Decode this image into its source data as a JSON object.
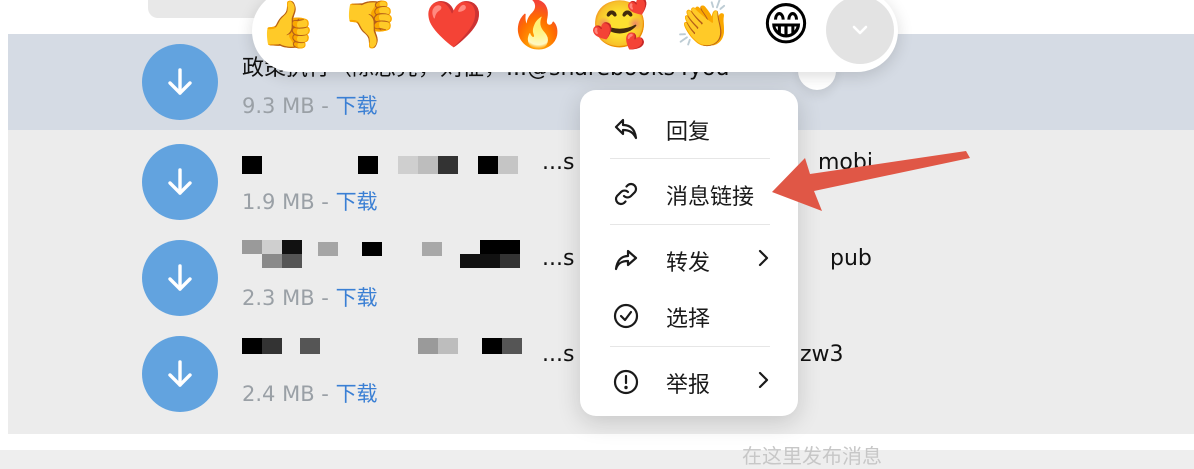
{
  "messages": [
    {
      "name": "政策执行（陈思亮，刘征，...@sharebooks4you",
      "size": "9.3 MB",
      "sep": "-",
      "action": "下载"
    },
    {
      "name": "...s",
      "name_tail": "mobi",
      "size": "1.9 MB",
      "sep": "-",
      "action": "下载"
    },
    {
      "name": "...s",
      "name_tail": "pub",
      "size": "2.3 MB",
      "sep": "-",
      "action": "下载"
    },
    {
      "name": "...s",
      "name_tail": "zw3",
      "size": "2.4 MB",
      "sep": "-",
      "action": "下载"
    }
  ],
  "reactions": [
    "👍",
    "👎",
    "❤️",
    "🔥",
    "🥰",
    "👏",
    "😁"
  ],
  "reaction_icons": [
    "thumbs-up",
    "thumbs-down",
    "red-heart",
    "fire",
    "smiling-face-with-hearts",
    "clapping-hands",
    "grinning-face"
  ],
  "context_menu": {
    "reply": "回复",
    "message_link": "消息链接",
    "forward": "转发",
    "select": "选择",
    "report": "举报"
  },
  "input_hint": "在这里发布消息",
  "colors": {
    "accent": "#62a3df",
    "link": "#3a7fd4",
    "selected_row": "#d5dbe4",
    "annotation_arrow": "#e05746"
  }
}
